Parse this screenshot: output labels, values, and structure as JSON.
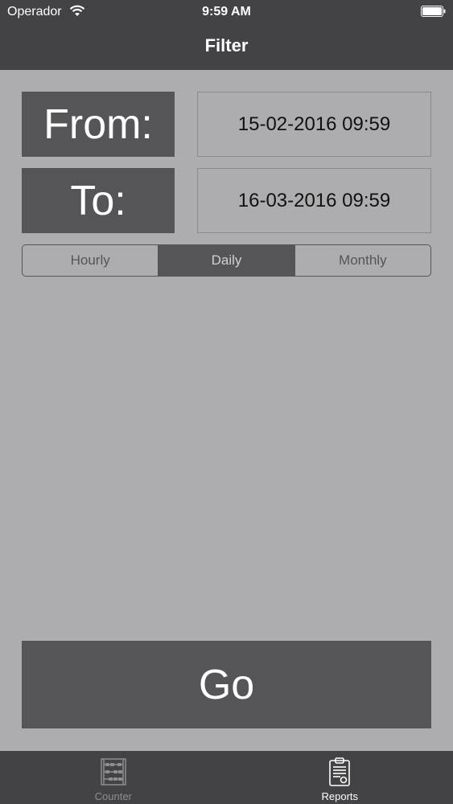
{
  "status_bar": {
    "carrier": "Operador",
    "time": "9:59 AM"
  },
  "nav": {
    "title": "Filter"
  },
  "filter": {
    "from_label": "From:",
    "from_value": "15-02-2016 09:59",
    "to_label": "To:",
    "to_value": "16-03-2016 09:59"
  },
  "segments": {
    "selected": "Daily",
    "items": [
      {
        "label": "Hourly"
      },
      {
        "label": "Daily"
      },
      {
        "label": "Monthly"
      }
    ]
  },
  "go_button": {
    "label": "Go"
  },
  "tab_bar": {
    "tabs": [
      {
        "label": "Counter",
        "icon": "abacus-icon",
        "active": false
      },
      {
        "label": "Reports",
        "icon": "clipboard-report-icon",
        "active": true
      }
    ]
  },
  "colors": {
    "bar_background": "#434244",
    "content_background": "#adacae",
    "dark_box": "#555457"
  }
}
